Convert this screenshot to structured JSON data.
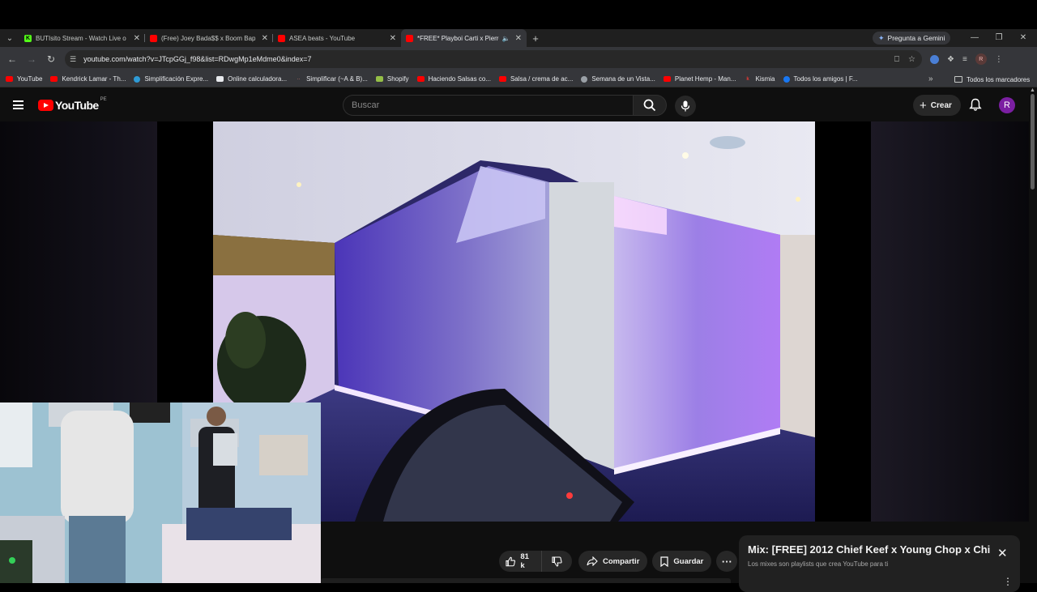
{
  "browser": {
    "tabs": [
      {
        "title": "BUTIsito Stream - Watch Live o",
        "favicon": "kick",
        "active": false
      },
      {
        "title": "(Free) Joey Bada$$ x Boom Bap",
        "favicon": "youtube",
        "active": false
      },
      {
        "title": "ASEA beats - YouTube",
        "favicon": "youtube",
        "active": false
      },
      {
        "title": "*FREE* Playboi Carti x Pierre",
        "favicon": "youtube",
        "active": true
      }
    ],
    "gemini_label": "Pregunta a Gemini",
    "url": "youtube.com/watch?v=JTcpGGj_f98&list=RDwgMp1eMdme0&index=7",
    "profile_initial": "R"
  },
  "bookmarks": {
    "items": [
      {
        "label": "YouTube",
        "icon": "youtube"
      },
      {
        "label": "Kendrick Lamar - Th...",
        "icon": "youtube"
      },
      {
        "label": "Simplificación Expre...",
        "icon": "symbolab"
      },
      {
        "label": "Online calculadora...",
        "icon": "calc"
      },
      {
        "label": "Simplificar (~A & B)...",
        "icon": "dots"
      },
      {
        "label": "Shopify",
        "icon": "shopify"
      },
      {
        "label": "Haciendo Salsas co...",
        "icon": "youtube"
      },
      {
        "label": "Salsa / crema de ac...",
        "icon": "youtube"
      },
      {
        "label": "Semana de un Vista...",
        "icon": "globe"
      },
      {
        "label": "Planet Hemp - Man...",
        "icon": "youtube"
      },
      {
        "label": "Kismia",
        "icon": "kismia"
      },
      {
        "label": "Todos los amigos | F...",
        "icon": "facebook"
      }
    ],
    "more": "»",
    "all_label": "Todos los marcadores"
  },
  "youtube": {
    "logo_text": "YouTube",
    "region": "PE",
    "search_placeholder": "Buscar",
    "create_label": "Crear",
    "avatar_initial": "R",
    "likes": "81 k",
    "share_label": "Compartir",
    "save_label": "Guardar",
    "mix": {
      "title": "Mix: [FREE] 2012 Chief Keef x Young Chop x Chi...",
      "subtitle": "Los mixes son playlists que crea YouTube para ti"
    }
  },
  "colors": {
    "youtube_red": "#ff0000",
    "avatar_purple": "#7b1fa2",
    "kick_green": "#53fc18",
    "chrome_toolbar": "#35363a"
  }
}
